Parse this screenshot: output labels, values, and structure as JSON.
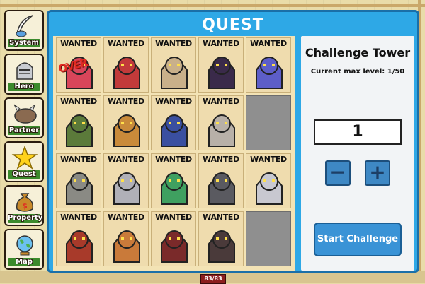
{
  "panel": {
    "title": "QUEST"
  },
  "side_menu": [
    {
      "label": "System",
      "icon": "quill-icon"
    },
    {
      "label": "Hero",
      "icon": "knight-helmet-icon"
    },
    {
      "label": "Partner",
      "icon": "beast-icon"
    },
    {
      "label": "Quest",
      "icon": "star-icon"
    },
    {
      "label": "Property",
      "icon": "money-bag-icon"
    },
    {
      "label": "Map",
      "icon": "globe-icon"
    }
  ],
  "wanted_label": "WANTED",
  "over_label": "OVER",
  "grid": [
    [
      "WANTED",
      "WANTED",
      "WANTED",
      "WANTED",
      "WANTED"
    ],
    [
      "WANTED",
      "WANTED",
      "WANTED",
      "WANTED",
      ""
    ],
    [
      "WANTED",
      "WANTED",
      "WANTED",
      "WANTED",
      "WANTED"
    ],
    [
      "WANTED",
      "WANTED",
      "WANTED",
      "WANTED",
      ""
    ]
  ],
  "challenge": {
    "title": "Challenge Tower",
    "subtitle": "Current max level: 1/50",
    "level_value": "1",
    "minus_label": "−",
    "plus_label": "+",
    "start_label": "Start Challenge"
  },
  "hp_badge": "83/83",
  "colors": {
    "panel": "#2ea8e6",
    "button": "#3a93d6",
    "empty_slot": "#8f8f8f"
  }
}
